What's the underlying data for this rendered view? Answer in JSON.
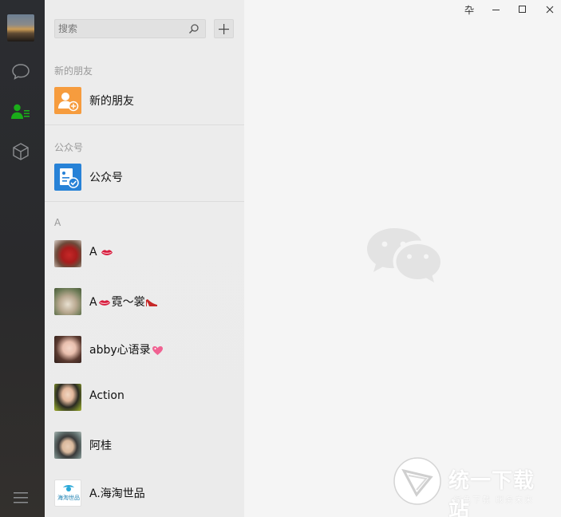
{
  "window_controls": {
    "pin": "卆",
    "minimize": "–",
    "maximize": "□",
    "close": "✕"
  },
  "search": {
    "placeholder": "搜索",
    "value": ""
  },
  "sections": {
    "new_friends_header": "新的朋友",
    "official_header": "公众号",
    "a_header": "A"
  },
  "items": {
    "new_friends": "新的朋友",
    "official_accounts": "公众号"
  },
  "contacts": [
    {
      "name": "A",
      "emoji": "lips"
    },
    {
      "name_parts": [
        "A",
        "霓～裳"
      ],
      "emoji": "lips-heel"
    },
    {
      "name": "abby心语录",
      "emoji": "sparkle-heart"
    },
    {
      "name": "Action"
    },
    {
      "name": "阿桂"
    },
    {
      "name": "A.海淘世品",
      "avatar_text": "海淘世品"
    }
  ],
  "watermark": {
    "title": "统一下载站",
    "subtitle": "绿色下载   服务未来"
  },
  "colors": {
    "accent_green": "#1aad19",
    "orange": "#f69c3e",
    "blue": "#2782d7"
  }
}
